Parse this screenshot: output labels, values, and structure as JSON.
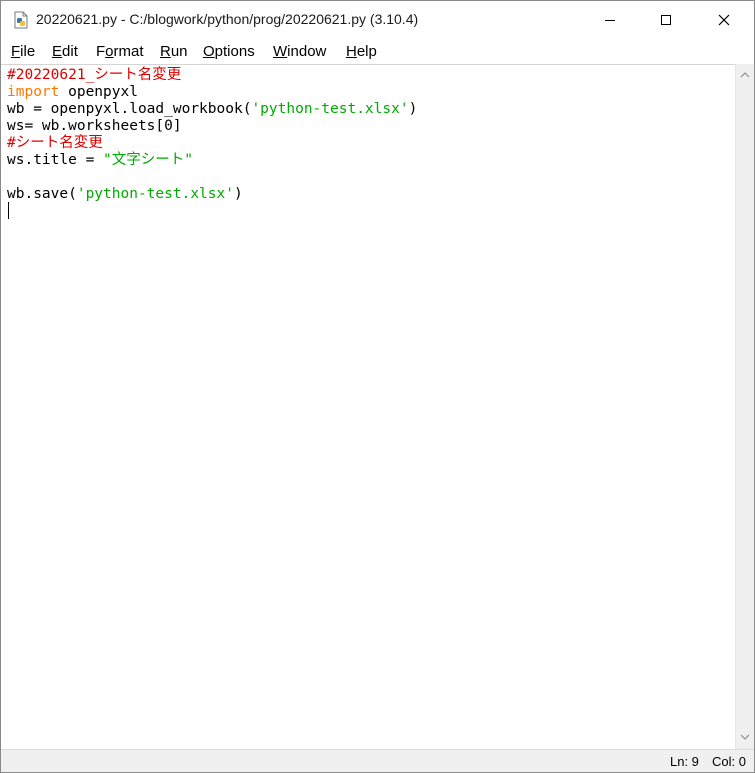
{
  "window": {
    "title": "20220621.py - C:/blogwork/python/prog/20220621.py (3.10.4)",
    "buttons": {
      "minimize": "minimize-icon",
      "maximize": "maximize-icon",
      "close": "close-icon"
    }
  },
  "menu": {
    "items": [
      {
        "label": "File",
        "mnemonic": "F",
        "rest": "ile"
      },
      {
        "label": "Edit",
        "mnemonic": "E",
        "rest": "dit"
      },
      {
        "label": "Format",
        "mnemonic": "o",
        "pre": "F",
        "rest": "rmat"
      },
      {
        "label": "Run",
        "mnemonic": "R",
        "rest": "un"
      },
      {
        "label": "Options",
        "mnemonic": "O",
        "rest": "ptions"
      },
      {
        "label": "Window",
        "mnemonic": "W",
        "rest": "indow"
      },
      {
        "label": "Help",
        "mnemonic": "H",
        "rest": "elp"
      }
    ]
  },
  "editor": {
    "lines": [
      [
        {
          "t": "#20220621_シート名変更",
          "c": "comment"
        }
      ],
      [
        {
          "t": "import",
          "c": "kw"
        },
        {
          "t": " openpyxl",
          "c": "plain"
        }
      ],
      [
        {
          "t": "wb = openpyxl.load_workbook(",
          "c": "plain"
        },
        {
          "t": "'python-test.xlsx'",
          "c": "str"
        },
        {
          "t": ")",
          "c": "plain"
        }
      ],
      [
        {
          "t": "ws= wb.worksheets[0]",
          "c": "plain"
        }
      ],
      [
        {
          "t": "#シート名変更",
          "c": "comment"
        }
      ],
      [
        {
          "t": "ws.title = ",
          "c": "plain"
        },
        {
          "t": "\"文字シート\"",
          "c": "str"
        }
      ],
      [
        {
          "t": "",
          "c": "plain"
        }
      ],
      [
        {
          "t": "wb.save(",
          "c": "plain"
        },
        {
          "t": "'python-test.xlsx'",
          "c": "str"
        },
        {
          "t": ")",
          "c": "plain"
        }
      ],
      [
        {
          "t": "",
          "c": "plain"
        }
      ]
    ]
  },
  "status": {
    "line": "Ln: 9",
    "col": "Col: 0"
  },
  "colors": {
    "comment": "#dd0000",
    "keyword": "#ff7700",
    "string": "#00aa00"
  }
}
